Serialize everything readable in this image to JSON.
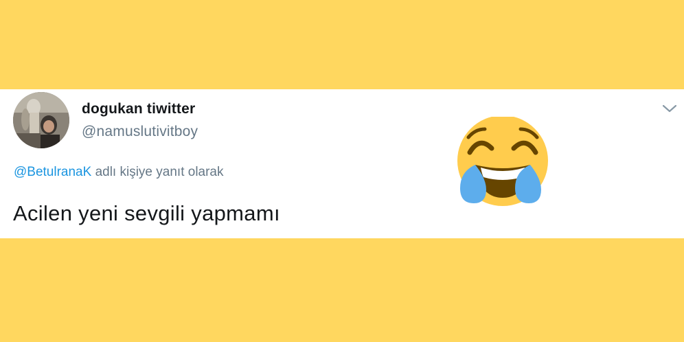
{
  "tweet": {
    "display_name": "dogukan tiwitter",
    "handle": "@namuslutivitboy",
    "reply_mention": "@BetulranaK",
    "reply_suffix": " adlı kişiye yanıt olarak",
    "text": "Acilen yeni sevgili yapmamı"
  },
  "icons": {
    "menu": "chevron-down-icon",
    "emoji": "face-with-tears-of-joy"
  },
  "colors": {
    "background": "#FFD75F",
    "card": "#FFFFFF",
    "name": "#14171A",
    "secondary": "#657786",
    "link": "#1B95E0"
  }
}
